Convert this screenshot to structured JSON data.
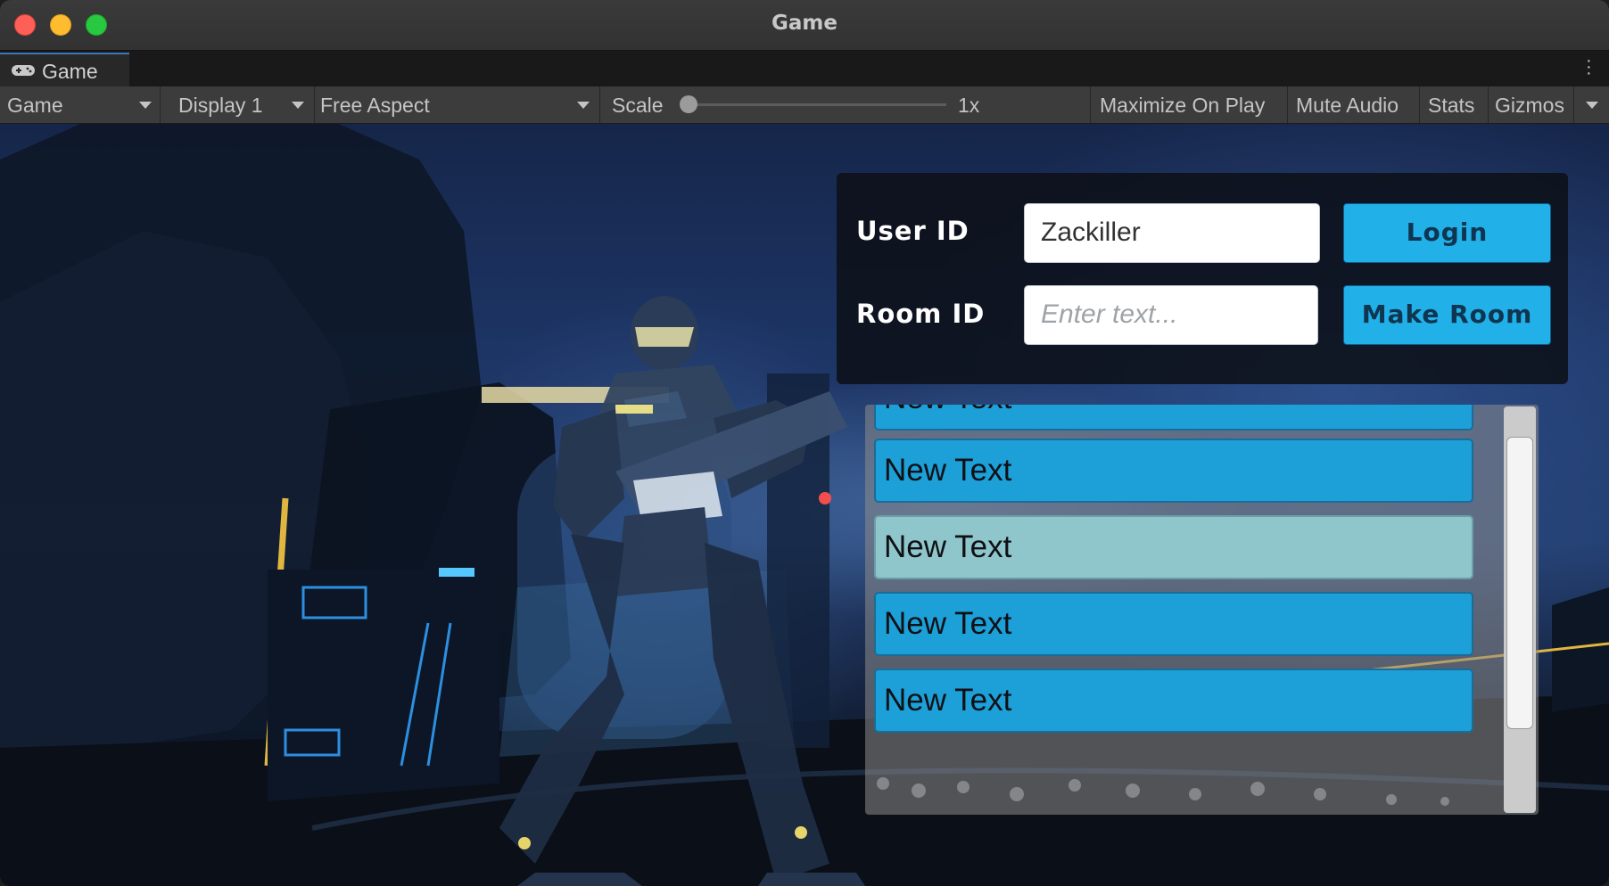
{
  "window": {
    "title": "Game"
  },
  "tabs": [
    {
      "label": "Game",
      "icon": "gamepad-icon"
    }
  ],
  "toolbar": {
    "view_select": "Game",
    "display_select": "Display 1",
    "aspect_select": "Free Aspect",
    "scale_label": "Scale",
    "scale_value": "1x",
    "scale_fraction": 0,
    "maximize_label": "Maximize On Play",
    "mute_label": "Mute Audio",
    "stats_label": "Stats",
    "gizmos_label": "Gizmos"
  },
  "login_panel": {
    "user_id_label": "User ID",
    "user_id_value": "Zackiller",
    "room_id_label": "Room ID",
    "room_id_placeholder": "Enter text...",
    "login_button": "Login",
    "make_room_button": "Make Room"
  },
  "room_list": {
    "items": [
      {
        "label": "New Text"
      },
      {
        "label": "New Text"
      },
      {
        "label": "New Text",
        "selected": true
      },
      {
        "label": "New Text"
      },
      {
        "label": "New Text"
      }
    ]
  },
  "colors": {
    "button_blue": "#22b0e8",
    "list_item_blue": "#1d9fd8",
    "list_item_selected": "#8fc6cc",
    "close": "#fe5f57",
    "minimize": "#febc2e",
    "maximize": "#28c840"
  }
}
